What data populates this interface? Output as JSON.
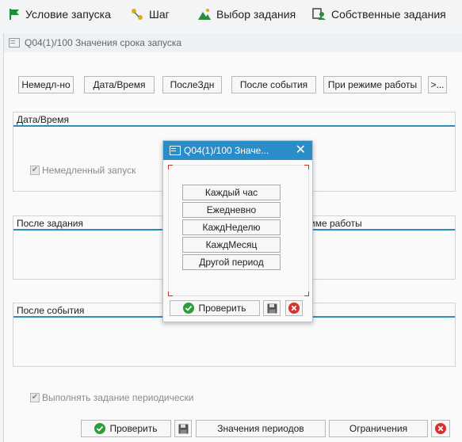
{
  "toolbar": {
    "start_condition": "Условие запуска",
    "step": "Шаг",
    "job_selection": "Выбор задания",
    "own_jobs": "Собственные задания"
  },
  "main_window": {
    "title": "Q04(1)/100 Значения срока запуска",
    "buttons": {
      "immediate": "Немедл-но",
      "datetime": "Дата/Время",
      "after_job": "ПослеЗдн",
      "after_event": "После события",
      "op_mode": "При режиме работы",
      "more": ">..."
    },
    "groups": {
      "datetime": "Дата/Время",
      "after_job": "После задания",
      "op_mode_partial": "жиме работы",
      "after_event": "После события"
    },
    "immediate_start_label": "Немедленный запуск",
    "periodic_label": "Выполнять задание периодически",
    "bottom": {
      "check": "Проверить",
      "period_values": "Значения периодов",
      "restrictions": "Ограничения"
    }
  },
  "popup": {
    "title": "Q04(1)/100 Значе...",
    "periods": [
      "Каждый час",
      "Ежедневно",
      "КаждНеделю",
      "КаждМесяц",
      "Другой период"
    ],
    "check": "Проверить"
  },
  "colors": {
    "accent": "#2b8dc8",
    "group_line": "#2d8dbf",
    "check_green": "#2e9e3c",
    "cancel_red": "#d9302b",
    "flag_green": "#1c8f3a"
  }
}
